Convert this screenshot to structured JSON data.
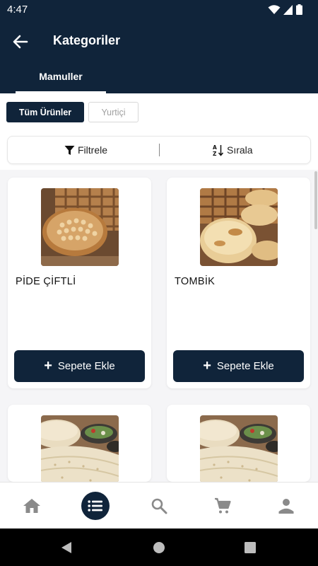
{
  "status_bar": {
    "time": "4:47"
  },
  "app_bar": {
    "title": "Kategoriler",
    "tab_label": "Mamuller"
  },
  "chips": [
    {
      "label": "Tüm Ürünler",
      "active": true
    },
    {
      "label": "Yurtiçi",
      "active": false
    }
  ],
  "toolbar": {
    "filter_label": "Filtrele",
    "sort_label": "Sırala"
  },
  "products": [
    {
      "name": "PİDE ÇİFTLİ",
      "button_label": "Sepete Ekle",
      "image": "pide-bread-photo"
    },
    {
      "name": "TOMBİK",
      "button_label": "Sepete Ekle",
      "image": "tombik-bread-photo"
    },
    {
      "name": "",
      "button_label": "",
      "image": "lavash-flatbread-photo"
    },
    {
      "name": "",
      "button_label": "",
      "image": "lavash-flatbread-photo"
    }
  ],
  "bottom_nav": [
    {
      "icon": "home-icon",
      "active": false
    },
    {
      "icon": "list-icon",
      "active": true
    },
    {
      "icon": "search-icon",
      "active": false
    },
    {
      "icon": "cart-icon",
      "active": false
    },
    {
      "icon": "person-icon",
      "active": false
    }
  ],
  "colors": {
    "primary": "#10243a",
    "background": "#f5f5f7",
    "card": "#ffffff"
  }
}
